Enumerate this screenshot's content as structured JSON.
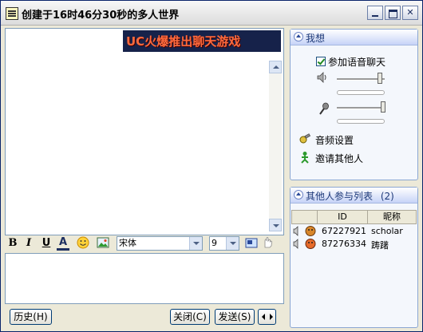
{
  "window": {
    "title": "创建于16时46分30秒的多人世界"
  },
  "banner": {
    "text": "UC火爆推出聊天游戏"
  },
  "toolbar": {
    "bold": "B",
    "italic": "I",
    "underline": "U",
    "color": "A",
    "font": "宋体",
    "size": "9"
  },
  "buttons": {
    "history": "历史(H)",
    "close": "关闭(C)",
    "send": "发送(S)"
  },
  "my_settings": {
    "header": "我想",
    "join_voice": "参加语音聊天",
    "audio_settings": "音频设置",
    "invite": "邀请其他人",
    "voice_checked": true,
    "speaker_level": 0.9,
    "mic_level": 0.96
  },
  "participants": {
    "header": "其他人参与列表",
    "count": "(2)",
    "columns": [
      "ID",
      "昵称"
    ],
    "rows": [
      {
        "id": "67227921",
        "nick": "scholar"
      },
      {
        "id": "87276334",
        "nick": "踌躇"
      }
    ]
  }
}
